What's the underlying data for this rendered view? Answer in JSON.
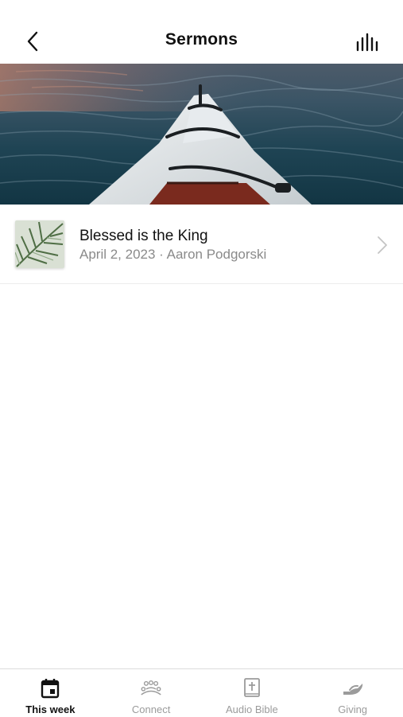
{
  "header": {
    "title": "Sermons",
    "back_icon": "chevron-left-icon",
    "audio_icon": "audio-bars-icon"
  },
  "hero": {
    "image": "kayak-bow-on-water"
  },
  "sermons": [
    {
      "title": "Blessed is the King",
      "meta": "April 2, 2023 · Aaron Podgorski",
      "thumbnail": "palm-leaves"
    }
  ],
  "tabbar": {
    "tabs": [
      {
        "label": "This week",
        "icon": "calendar-icon",
        "active": true
      },
      {
        "label": "Connect",
        "icon": "people-group-icon",
        "active": false
      },
      {
        "label": "Audio Bible",
        "icon": "bible-icon",
        "active": false
      },
      {
        "label": "Giving",
        "icon": "giving-hand-icon",
        "active": false
      }
    ]
  },
  "colors": {
    "text": "#111111",
    "secondary_text": "#8a8a8a",
    "inactive_tab": "#9b9b9b"
  }
}
